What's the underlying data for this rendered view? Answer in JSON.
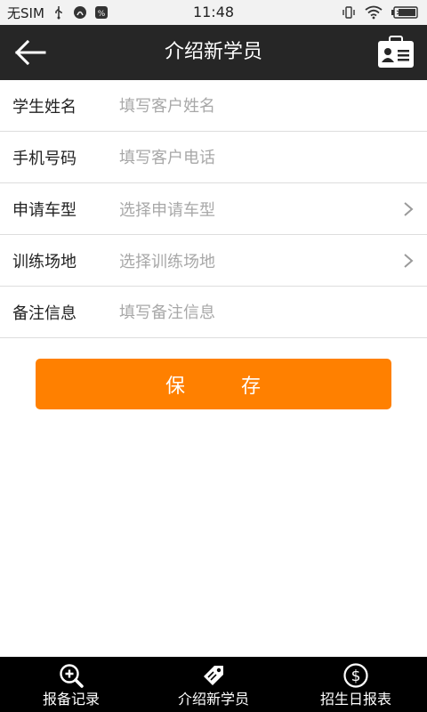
{
  "status_bar": {
    "carrier": "无SIM",
    "time": "11:48",
    "icons_left": [
      "usb-icon",
      "notification-icon",
      "app-icon"
    ],
    "icons_right": [
      "vibrate-icon",
      "wifi-icon",
      "battery-icon"
    ]
  },
  "header": {
    "title": "介绍新学员",
    "back_icon": "arrow-left-icon",
    "right_icon": "id-card-icon"
  },
  "form": {
    "rows": [
      {
        "label": "学生姓名",
        "placeholder": "填写客户姓名",
        "type": "input"
      },
      {
        "label": "手机号码",
        "placeholder": "填写客户电话",
        "type": "input"
      },
      {
        "label": "申请车型",
        "value": "选择申请车型",
        "type": "select"
      },
      {
        "label": "训练场地",
        "value": "选择训练场地",
        "type": "select"
      },
      {
        "label": "备注信息",
        "placeholder": "填写备注信息",
        "type": "input"
      }
    ]
  },
  "save": {
    "char1": "保",
    "char2": "存",
    "color": "#ff8000"
  },
  "bottom_nav": {
    "items": [
      {
        "label": "报备记录",
        "icon": "search-plus-icon"
      },
      {
        "label": "介绍新学员",
        "icon": "tag-icon"
      },
      {
        "label": "招生日报表",
        "icon": "dollar-circle-icon"
      }
    ]
  },
  "colors": {
    "header_bg": "#262626",
    "nav_bg": "#000000",
    "accent": "#ff8000"
  }
}
